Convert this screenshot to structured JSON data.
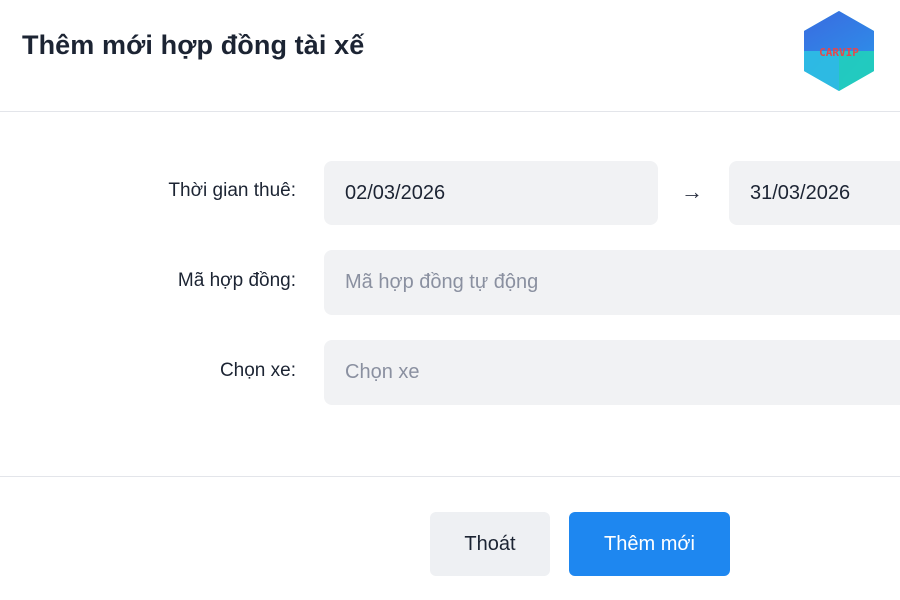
{
  "dialog": {
    "title": "Thêm mới hợp đồng tài xế",
    "logo_text": "CARVIP"
  },
  "form": {
    "rental_period": {
      "label": "Thời gian thuê:",
      "start_date": "02/03/2026",
      "arrow": "→",
      "end_date": "31/03/2026"
    },
    "contract_code": {
      "label": "Mã hợp đồng:",
      "placeholder": "Mã hợp đồng tự động"
    },
    "vehicle": {
      "label": "Chọn xe:",
      "placeholder": "Chọn xe"
    }
  },
  "footer": {
    "cancel_label": "Thoát",
    "submit_label": "Thêm mới"
  },
  "colors": {
    "primary": "#1e87f0",
    "field_background": "#f1f2f4",
    "placeholder_text": "#8a90a0",
    "logo_red": "#e5484d",
    "logo_blue": "#3a6be0",
    "logo_teal": "#22c9c0"
  }
}
